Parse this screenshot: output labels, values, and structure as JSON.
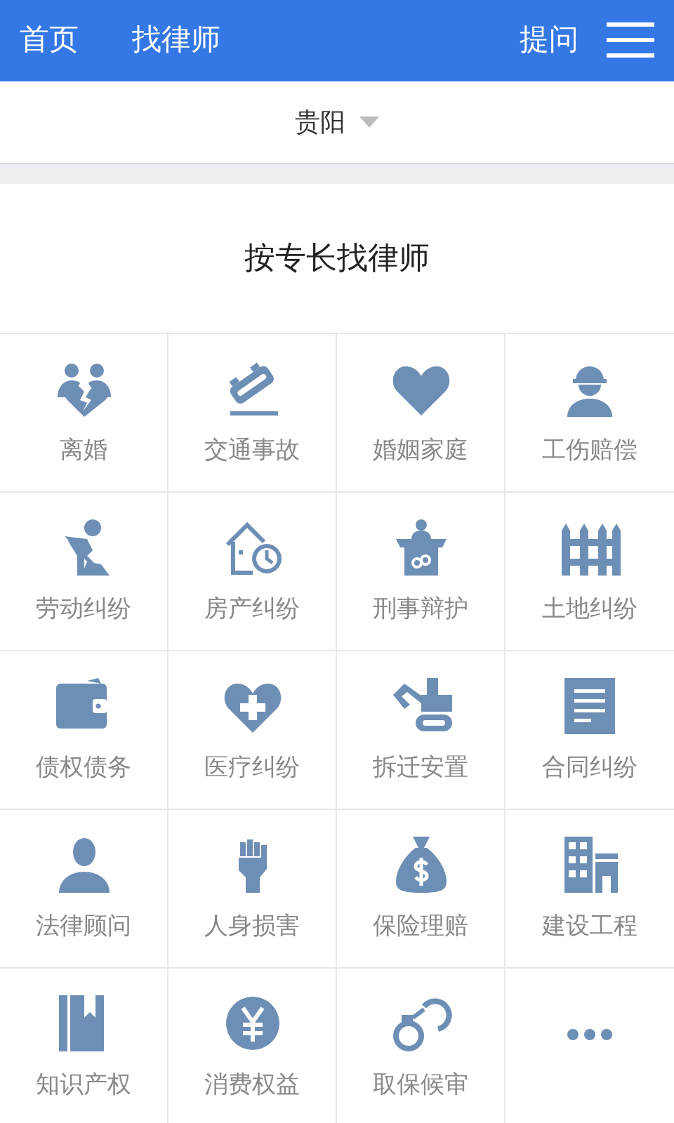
{
  "header": {
    "nav": [
      {
        "label": "首页"
      },
      {
        "label": "找律师"
      }
    ],
    "ask": "提问"
  },
  "city": {
    "value": "贵阳"
  },
  "section": {
    "title": "按专长找律师"
  },
  "categories": [
    {
      "kind": "category",
      "label": "离婚"
    },
    {
      "kind": "category",
      "label": "交通事故"
    },
    {
      "kind": "category",
      "label": "婚姻家庭"
    },
    {
      "kind": "category",
      "label": "工伤赔偿"
    },
    {
      "kind": "category",
      "label": "劳动纠纷"
    },
    {
      "kind": "category",
      "label": "房产纠纷"
    },
    {
      "kind": "category",
      "label": "刑事辩护"
    },
    {
      "kind": "category",
      "label": "土地纠纷"
    },
    {
      "kind": "category",
      "label": "债权债务"
    },
    {
      "kind": "category",
      "label": "医疗纠纷"
    },
    {
      "kind": "category",
      "label": "拆迁安置"
    },
    {
      "kind": "category",
      "label": "合同纠纷"
    },
    {
      "kind": "category",
      "label": "法律顾问"
    },
    {
      "kind": "category",
      "label": "人身损害"
    },
    {
      "kind": "category",
      "label": "保险理赔"
    },
    {
      "kind": "category",
      "label": "建设工程"
    },
    {
      "kind": "category",
      "label": "知识产权"
    },
    {
      "kind": "category",
      "label": "消费权益"
    },
    {
      "kind": "category",
      "label": "取保候审"
    },
    {
      "kind": "more"
    }
  ]
}
